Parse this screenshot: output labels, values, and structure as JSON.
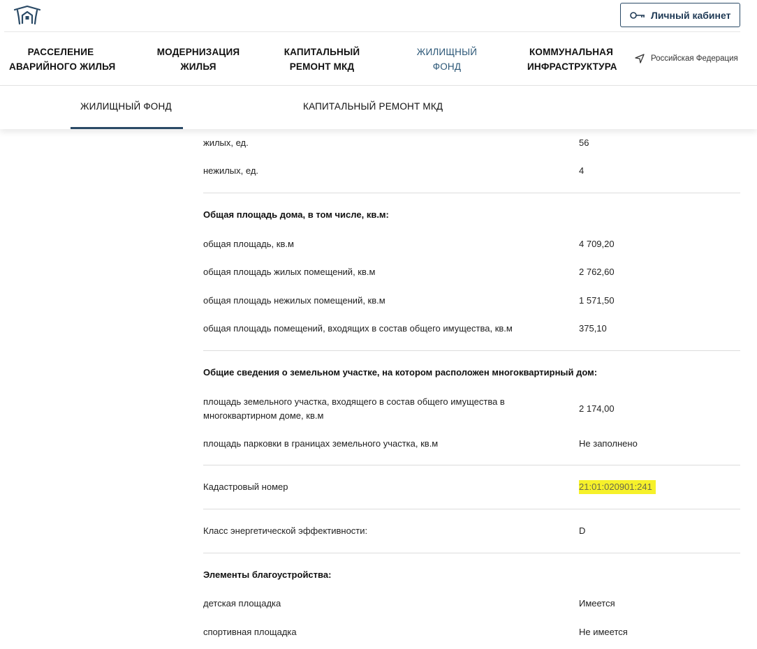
{
  "header": {
    "cabinet_label": "Личный кабинет"
  },
  "nav": {
    "items": [
      {
        "line1": "РАССЕЛЕНИЕ",
        "line2": "АВАРИЙНОГО ЖИЛЬЯ"
      },
      {
        "line1": "МОДЕРНИЗАЦИЯ",
        "line2": "ЖИЛЬЯ"
      },
      {
        "line1": "КАПИТАЛЬНЫЙ",
        "line2": "РЕМОНТ МКД"
      },
      {
        "line1": "ЖИЛИЩНЫЙ",
        "line2": "ФОНД"
      },
      {
        "line1": "КОММУНАЛЬНАЯ",
        "line2": "ИНФРАСТРУКТУРА"
      }
    ],
    "region": "Российская Федерация"
  },
  "subtabs": {
    "items": [
      "ЖИЛИЩНЫЙ ФОНД",
      "КАПИТАЛЬНЫЙ РЕМОНТ МКД"
    ]
  },
  "rows": {
    "living": {
      "label": "жилых, ед.",
      "value": "56"
    },
    "nonliving": {
      "label": "нежилых, ед.",
      "value": "4"
    },
    "area_title": "Общая площадь дома, в том числе, кв.м:",
    "total_area": {
      "label": "общая площадь, кв.м",
      "value": "4 709,20"
    },
    "living_area": {
      "label": "общая площадь жилых помещений, кв.м",
      "value": "2 762,60"
    },
    "nonliving_area": {
      "label": "общая площадь нежилых помещений, кв.м",
      "value": "1 571,50"
    },
    "common_area": {
      "label": "общая площадь помещений, входящих в состав общего имущества, кв.м",
      "value": "375,10"
    },
    "land_title": "Общие сведения о земельном участке, на котором расположен многоквартирный дом:",
    "land_area": {
      "label": "площадь земельного участка, входящего в состав общего имущества в многоквартирном доме, кв.м",
      "value": "2 174,00"
    },
    "parking_area": {
      "label": "площадь парковки в границах земельного участка, кв.м",
      "value": "Не заполнено"
    },
    "cadastral": {
      "label": "Кадастровый номер",
      "value": "21:01:020901:241"
    },
    "energy": {
      "label": "Класс энергетической эффективности:",
      "value": "D"
    },
    "amenities_title": "Элементы благоустройства:",
    "playground": {
      "label": "детская площадка",
      "value": "Имеется"
    },
    "sports": {
      "label": "спортивная площадка",
      "value": "Не имеется"
    }
  },
  "colors": {
    "accent": "#2a4a66",
    "active_nav": "#2a5676",
    "highlight": "#f6f12a"
  }
}
